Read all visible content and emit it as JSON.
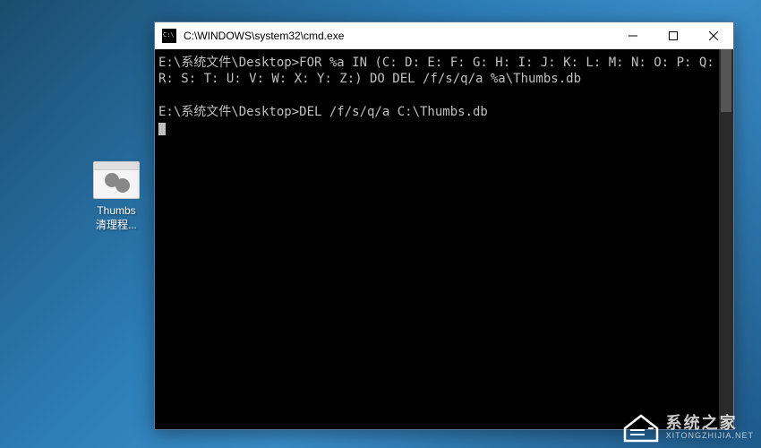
{
  "desktop": {
    "icon_label_line1": "Thumbs",
    "icon_label_line2": "清理程..."
  },
  "window": {
    "title": "C:\\WINDOWS\\system32\\cmd.exe"
  },
  "terminal": {
    "line1": "E:\\系统文件\\Desktop>FOR %a IN (C: D: E: F: G: H: I: J: K: L: M: N: O: P: Q: R: S: T: U: V: W: X: Y: Z:) DO DEL /f/s/q/a %a\\Thumbs.db",
    "line2": "",
    "line3": "E:\\系统文件\\Desktop>DEL /f/s/q/a C:\\Thumbs.db"
  },
  "watermark": {
    "cn": "系统之家",
    "en": "XITONGZHIJIA.NET"
  }
}
